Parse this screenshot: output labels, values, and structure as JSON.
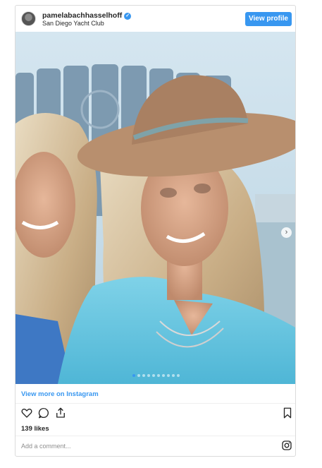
{
  "header": {
    "username": "pamelabachhasselhoff",
    "location": "San Diego Yacht Club",
    "view_profile_label": "View profile",
    "verified_icon": "verified-badge-icon"
  },
  "carousel": {
    "slide_count": 10,
    "active_index": 0,
    "next_icon": "chevron-right-icon",
    "next_glyph": "›"
  },
  "footer": {
    "view_more_label": "View more on Instagram",
    "likes_label": "139 likes",
    "comment_placeholder": "Add a comment...",
    "icons": [
      "heart-icon",
      "comment-icon",
      "share-icon",
      "bookmark-icon",
      "instagram-icon"
    ]
  },
  "colors": {
    "accent": "#3897f0",
    "text": "#262626",
    "muted": "#8e8e8e",
    "border": "#dbdbdb"
  }
}
